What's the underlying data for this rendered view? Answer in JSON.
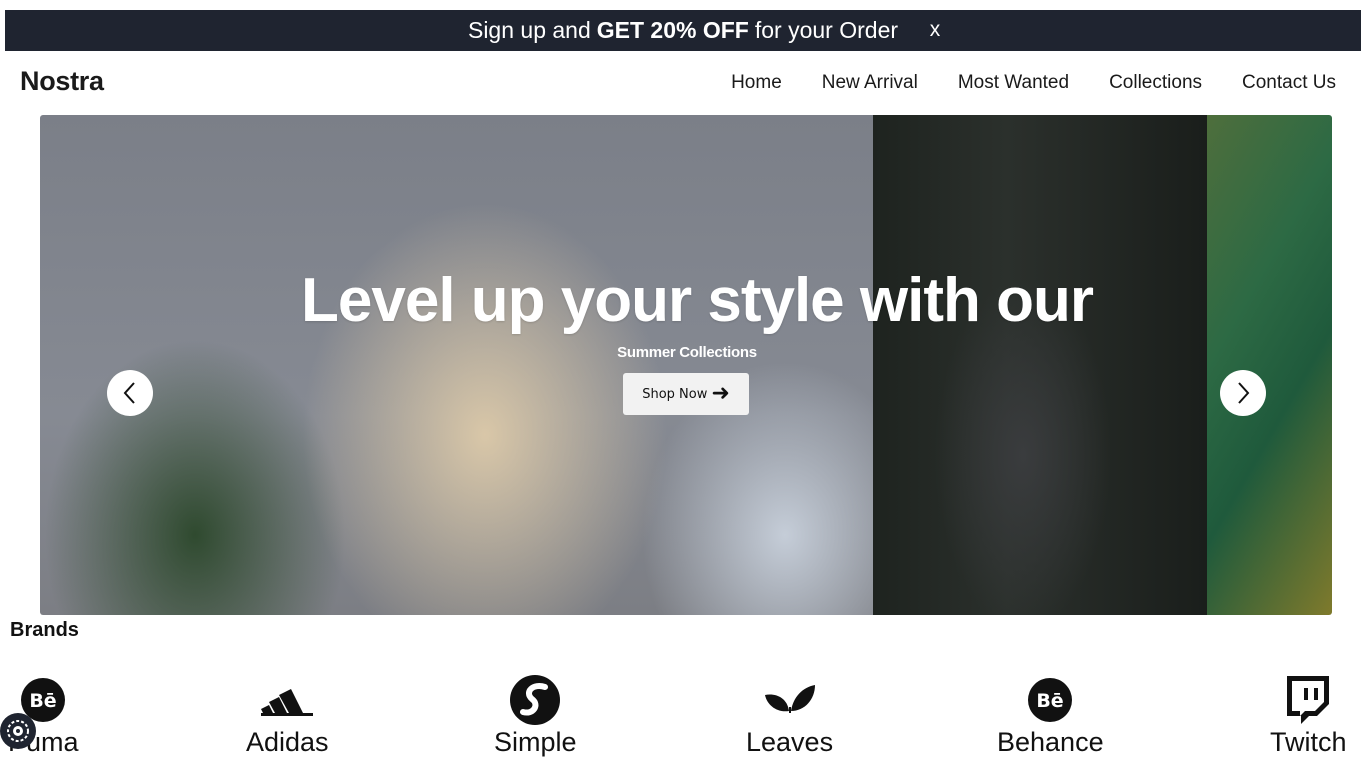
{
  "promo": {
    "pre": "Sign up and",
    "bold": "GET 20% OFF",
    "post": "for your Order",
    "close": "x"
  },
  "header": {
    "logo": "Nostra",
    "nav": [
      "Home",
      "New Arrival",
      "Most Wanted",
      "Collections",
      "Contact Us"
    ]
  },
  "hero": {
    "title": "Level up your style with our",
    "subtitle": "Summer Collections",
    "button": "Shop Now"
  },
  "brands": {
    "heading": "Brands",
    "items": [
      {
        "label": "Puma",
        "icon": "behance-icon"
      },
      {
        "label": "Adidas",
        "icon": "adidas-icon"
      },
      {
        "label": "Simple",
        "icon": "simple-icon"
      },
      {
        "label": "Leaves",
        "icon": "leaves-icon"
      },
      {
        "label": "Behance",
        "icon": "behance-icon"
      },
      {
        "label": "Twitch",
        "icon": "twitch-icon"
      }
    ]
  },
  "colors": {
    "promo_bg": "#1f2430",
    "text": "#111111",
    "button_bg": "#f2f2f2"
  }
}
